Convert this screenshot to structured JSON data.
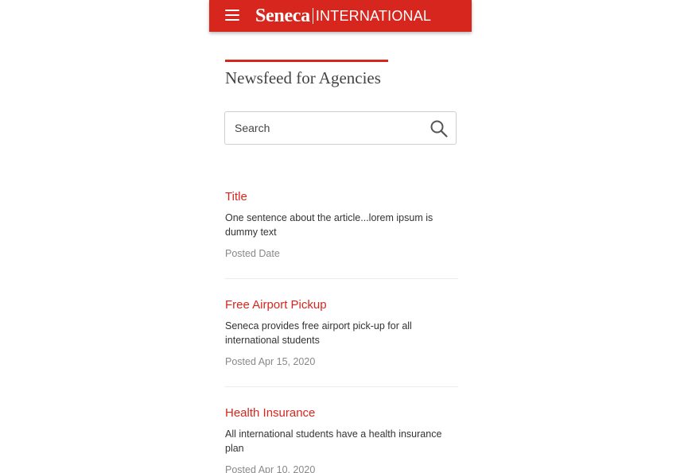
{
  "header": {
    "brand": "Seneca",
    "sub_brand": "INTERNATIONAL",
    "menu_icon": "hamburger-menu-icon",
    "background_color": "#d7261e"
  },
  "page": {
    "title": "Newsfeed for Agencies"
  },
  "search": {
    "placeholder": "Search",
    "value": "",
    "icon": "search-icon"
  },
  "articles": [
    {
      "title": "Title",
      "summary": "One sentence about the article...lorem ipsum is dummy text",
      "date": "Posted Date"
    },
    {
      "title": "Free Airport Pickup",
      "summary": "Seneca provides free airport pick-up for all international students",
      "date": "Posted Apr 15, 2020"
    },
    {
      "title": "Health Insurance",
      "summary": "All international students have a health insurance plan",
      "date": "Posted Apr 10, 2020"
    }
  ],
  "colors": {
    "accent": "#d7261e",
    "text": "#333333",
    "muted": "#888888"
  }
}
